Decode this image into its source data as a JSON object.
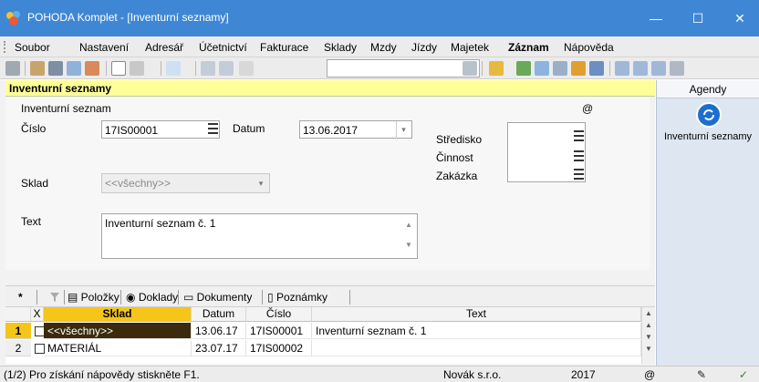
{
  "window": {
    "title": "POHODA Komplet - [Inventurní seznamy]",
    "controls": {
      "minimize": "—",
      "maximize": "☐",
      "close": "✕"
    }
  },
  "menu": {
    "items": [
      "Soubor",
      "Nastavení",
      "Adresář",
      "Účetnictví",
      "Fakturace",
      "Sklady",
      "Mzdy",
      "Jízdy",
      "Majetek",
      "Záznam",
      "Nápověda"
    ]
  },
  "toolbar": {
    "combo_value": ""
  },
  "header": {
    "title": "Inventurní seznamy"
  },
  "form": {
    "section_label": "Inventurní seznam",
    "at_symbol": "@",
    "cislo_label": "Číslo",
    "cislo_value": "17IS00001",
    "datum_label": "Datum",
    "datum_value": "13.06.2017",
    "sklad_label": "Sklad",
    "sklad_value": "<<všechny>>",
    "text_label": "Text",
    "text_value": "Inventurní seznam č. 1",
    "stredisko_label": "Středisko",
    "cinnost_label": "Činnost",
    "zakazka_label": "Zakázka"
  },
  "tabs": {
    "star": "*",
    "items": [
      "Položky",
      "Doklady",
      "Dokumenty",
      "Poznámky"
    ]
  },
  "grid": {
    "columns": {
      "x": "X",
      "sklad": "Sklad",
      "datum": "Datum",
      "cislo": "Číslo",
      "text": "Text"
    },
    "rows": [
      {
        "num": "1",
        "sklad": "<<všechny>>",
        "datum": "13.06.17",
        "cislo": "17IS00001",
        "text": "Inventurní seznam č. 1"
      },
      {
        "num": "2",
        "sklad": "MATERIÁL",
        "datum": "23.07.17",
        "cislo": "17IS00002",
        "text": ""
      }
    ]
  },
  "status": {
    "help": "(1/2) Pro získání nápovědy stiskněte F1.",
    "company": "Novák s.r.o.",
    "year": "2017",
    "at": "@"
  },
  "agenda": {
    "header": "Agendy",
    "item_label": "Inventurní seznamy"
  },
  "colors": {
    "titlebar": "#3f87d4",
    "header_yellow": "#ffff99",
    "selected_row": "#3c2a0e",
    "sklad_header": "#f5c518"
  }
}
